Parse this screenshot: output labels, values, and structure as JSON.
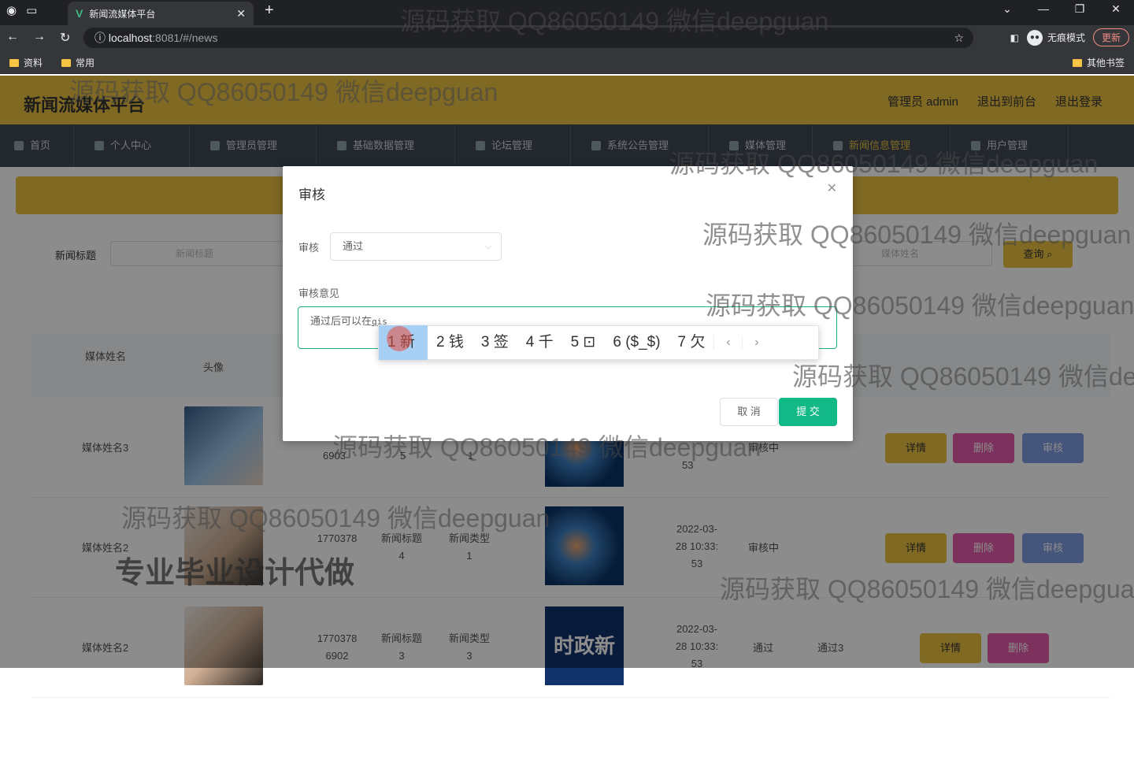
{
  "browser": {
    "tab_title": "新闻流媒体平台",
    "url_host": "localhost",
    "url_path": ":8081/#/news",
    "incognito_label": "无痕模式",
    "update_label": "更新",
    "bookmarks": [
      "资料",
      "常用"
    ],
    "other_bookmarks": "其他书签"
  },
  "app": {
    "brand": "新闻流媒体平台",
    "header_links": [
      "管理员 admin",
      "退出到前台",
      "退出登录"
    ],
    "menu": [
      "首页",
      "个人中心",
      "管理员管理",
      "基础数据管理",
      "论坛管理",
      "系统公告管理",
      "媒体管理",
      "新闻信息管理",
      "用户管理"
    ],
    "filter_label": "新闻标题",
    "filter_placeholder": "新闻标题",
    "filter_placeholder2": "媒体姓名",
    "query_label": "查询",
    "table_headers": [
      "媒体姓名",
      "头像"
    ],
    "rows": [
      {
        "name": "媒体姓名3",
        "id": "6903",
        "title": "5",
        "type": "1",
        "time": "53",
        "status": "审核中",
        "opinion": "",
        "image_label": ""
      },
      {
        "name": "媒体姓名2",
        "id": "1770378",
        "title": "新闻标题 4",
        "type": "新闻类型 1",
        "time": "2022-03- 28 10:33: 53",
        "status": "审核中",
        "opinion": "",
        "image_label": ""
      },
      {
        "name": "媒体姓名2",
        "id": "1770378 6902",
        "title": "新闻标题 3",
        "type": "新闻类型 3",
        "time": "2022-03- 28 10:33: 53",
        "status": "通过",
        "opinion": "通过3",
        "image_label": "时政新闻"
      }
    ],
    "actions": {
      "detail": "详情",
      "delete": "删除",
      "audit": "审核"
    }
  },
  "dialog": {
    "title": "审核",
    "audit_label": "审核",
    "audit_value": "通过",
    "opinion_label": "审核意见",
    "opinion_text": "通过后可以在",
    "opinion_composing": "qis",
    "cancel_label": "取 消",
    "submit_label": "提 交"
  },
  "ime": {
    "candidates": [
      "1 新",
      "2 钱",
      "3 签",
      "4 千",
      "5 ⊡",
      "6 ($_$)",
      "7 欠"
    ]
  },
  "watermarks": {
    "text": "源码获取 QQ86050149 微信deepguan",
    "promo": "专业毕业设计代做"
  }
}
